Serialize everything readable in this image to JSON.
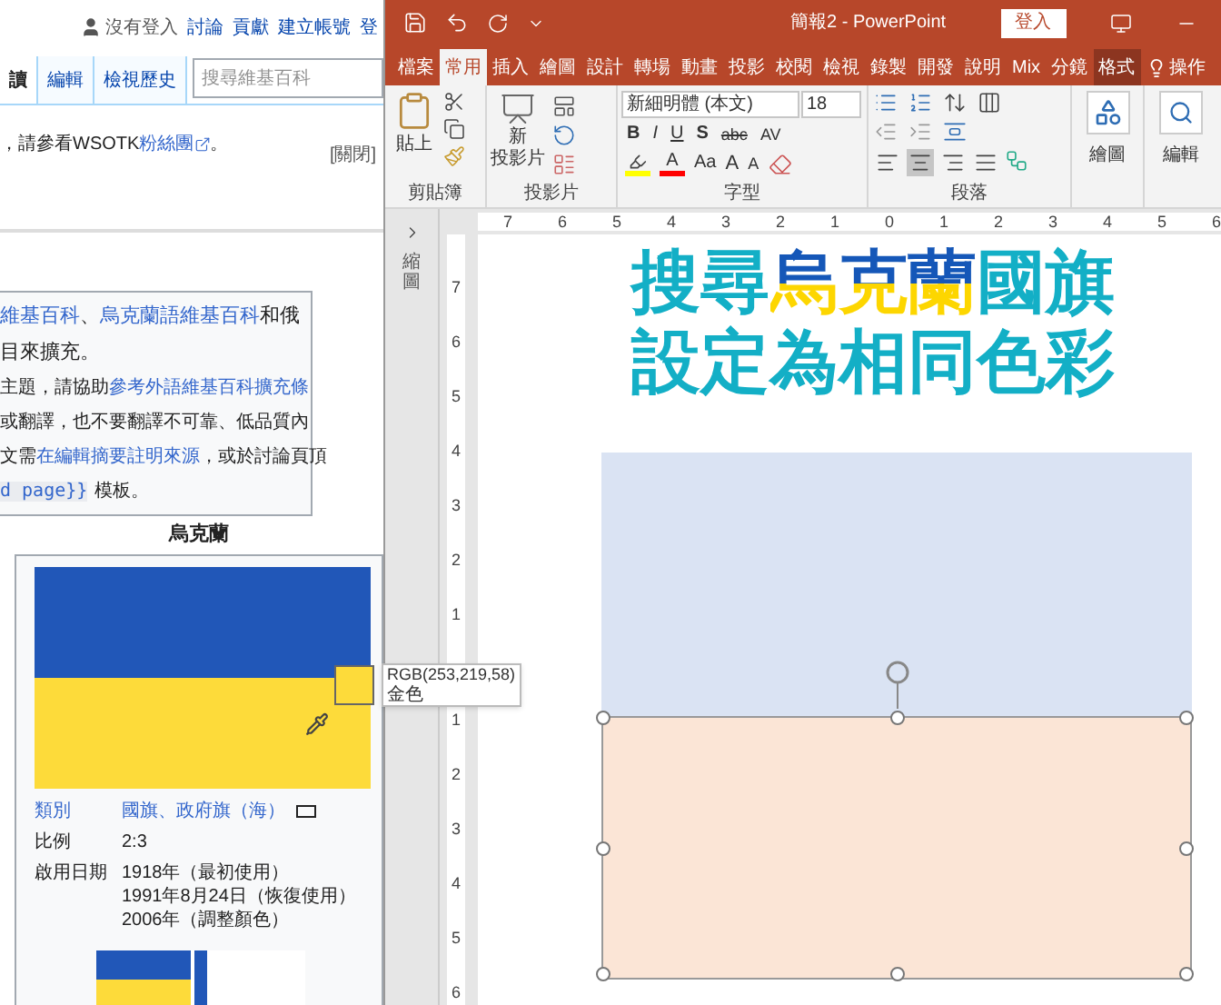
{
  "wiki": {
    "user_links": [
      {
        "text": "沒有登入",
        "kind": "user"
      },
      {
        "text": "討論",
        "kind": "link"
      },
      {
        "text": "貢獻",
        "kind": "link"
      },
      {
        "text": "建立帳號",
        "kind": "link"
      },
      {
        "text": "登",
        "kind": "link"
      }
    ],
    "tabs": [
      {
        "label": "讀",
        "selected": true
      },
      {
        "label": "編輯",
        "selected": false
      },
      {
        "label": "檢視歷史",
        "selected": false
      }
    ],
    "search": {
      "placeholder": "搜尋維基百科"
    },
    "notice": {
      "before": "，請參看WSOTK",
      "link": "粉絲團",
      "after": "。",
      "close": "[關閉]"
    },
    "message_box": {
      "lines": [
        [
          {
            "text": "維基百科",
            "kind": "link"
          },
          {
            "text": "、",
            "kind": "plain"
          },
          {
            "text": "烏克蘭語維基百科",
            "kind": "link"
          },
          {
            "text": "和俄",
            "kind": "plain"
          }
        ],
        [
          {
            "text": "目來擴充。",
            "kind": "plain"
          }
        ],
        [
          {
            "text": "主題，請協助",
            "kind": "small"
          },
          {
            "text": "參考外語維基百科擴充條",
            "kind": "smalllink"
          }
        ],
        [
          {
            "text": "或翻譯，也不要翻譯不可靠、低品質內",
            "kind": "small"
          }
        ],
        [
          {
            "text": "文需",
            "kind": "small"
          },
          {
            "text": "在編輯摘要註明來源",
            "kind": "smalllink"
          },
          {
            "text": "，或於討論頁頂",
            "kind": "small"
          }
        ],
        [
          {
            "text": "d page}}",
            "kind": "code"
          },
          {
            "text": "模板。",
            "kind": "small"
          }
        ]
      ]
    },
    "infobox": {
      "title": "烏克蘭",
      "rows": [
        {
          "label": "類別",
          "link": true,
          "values": [
            "國旗、政府旗（海）"
          ]
        },
        {
          "label": "比例",
          "link": false,
          "values": [
            "2:3"
          ]
        },
        {
          "label": "啟用日期",
          "link": false,
          "values": [
            "1918年（最初使用）",
            "1991年8月24日（恢復使用）",
            "2006年（調整顏色）"
          ]
        }
      ]
    }
  },
  "color_tooltip": {
    "rgb": "RGB(253,219,58)",
    "name": "金色",
    "color": "#fddb3a"
  },
  "ppt": {
    "title": "簡報2 - PowerPoint",
    "sign_in": "登入",
    "tabs": [
      {
        "label": "檔案",
        "selected": false,
        "kind": "file"
      },
      {
        "label": "常用",
        "selected": true,
        "kind": "normal"
      },
      {
        "label": "插入",
        "selected": false,
        "kind": "normal"
      },
      {
        "label": "繪圖",
        "selected": false,
        "kind": "normal"
      },
      {
        "label": "設計",
        "selected": false,
        "kind": "normal"
      },
      {
        "label": "轉場",
        "selected": false,
        "kind": "normal"
      },
      {
        "label": "動畫",
        "selected": false,
        "kind": "normal"
      },
      {
        "label": "投影",
        "selected": false,
        "kind": "normal"
      },
      {
        "label": "校閱",
        "selected": false,
        "kind": "normal"
      },
      {
        "label": "檢視",
        "selected": false,
        "kind": "normal"
      },
      {
        "label": "錄製",
        "selected": false,
        "kind": "normal"
      },
      {
        "label": "開發",
        "selected": false,
        "kind": "normal"
      },
      {
        "label": "說明",
        "selected": false,
        "kind": "normal"
      },
      {
        "label": "Mix",
        "selected": false,
        "kind": "normal"
      },
      {
        "label": "分鏡",
        "selected": false,
        "kind": "normal"
      },
      {
        "label": "格式",
        "selected": false,
        "kind": "contextual"
      },
      {
        "label": "操作",
        "selected": false,
        "kind": "tell"
      }
    ],
    "ribbon": {
      "clipboard": {
        "name": "剪貼簿",
        "paste": "貼上"
      },
      "slides": {
        "name": "投影片",
        "new_slide": [
          "新",
          "投影片"
        ]
      },
      "font": {
        "name": "字型",
        "font_name": "新細明體 (本文)",
        "font_size": "18",
        "row1": [
          {
            "label": "B",
            "kind": "bold"
          },
          {
            "label": "I",
            "kind": "italic"
          },
          {
            "label": "U",
            "kind": "underline"
          },
          {
            "label": "S",
            "kind": "shadow"
          },
          {
            "label": "abc",
            "kind": "strike"
          },
          {
            "label": "AV",
            "kind": "spacing"
          }
        ],
        "row2": [
          {
            "kind": "highlight",
            "color": "#ffff00"
          },
          {
            "kind": "fontcolor",
            "label": "A",
            "color": "#ff0000"
          },
          {
            "kind": "case",
            "label": "Aa"
          },
          {
            "kind": "grow",
            "label": "A"
          },
          {
            "kind": "shrink",
            "label": "A"
          },
          {
            "kind": "clear"
          }
        ]
      },
      "paragraph": {
        "name": "段落",
        "align": [
          {
            "kind": "left",
            "selected": false
          },
          {
            "kind": "center",
            "selected": true
          },
          {
            "kind": "right",
            "selected": false
          },
          {
            "kind": "justify",
            "selected": false
          }
        ]
      },
      "drawing": {
        "name": "繪圖"
      },
      "editing": {
        "name": "編輯"
      }
    },
    "ruler": {
      "horizontal": [
        "7",
        "6",
        "5",
        "4",
        "3",
        "2",
        "1",
        "0",
        "1",
        "2",
        "3",
        "4",
        "5",
        "6"
      ],
      "vertical_upper": [
        "7",
        "6",
        "5",
        "4",
        "3",
        "2",
        "1"
      ],
      "vertical_lower": [
        "1",
        "2",
        "3",
        "4",
        "5",
        "6"
      ]
    },
    "thumbnails_label": "縮圖",
    "slide": {
      "title_lines": [
        [
          {
            "text": "搜尋",
            "kind": "plain"
          },
          {
            "text": "烏克蘭",
            "kind": "flag"
          },
          {
            "text": "國旗",
            "kind": "plain"
          }
        ],
        [
          {
            "text": "設定為相同色彩",
            "kind": "plain"
          }
        ]
      ],
      "shapes": [
        {
          "color": "#dae3f3",
          "selected": false
        },
        {
          "color": "#fbe5d6",
          "selected": true
        }
      ]
    }
  }
}
